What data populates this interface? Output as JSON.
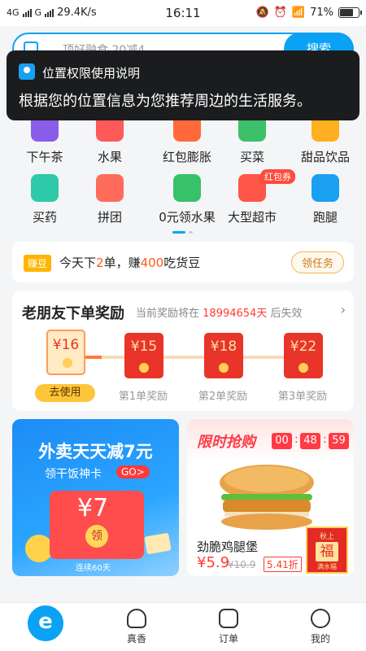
{
  "status_bar": {
    "network_1": "4G",
    "network_2": "G",
    "speed": "29.4K/s",
    "time": "16:11",
    "battery_percent": "71%",
    "battery_level": 0.71
  },
  "search": {
    "placeholder": "顶好融食 20减4",
    "button_label": "搜索"
  },
  "toast": {
    "title": "位置权限使用说明",
    "body": "根据您的位置信息为您推荐周边的生活服务。"
  },
  "categories": [
    {
      "label": "下午茶",
      "icon": "milk-tea-icon",
      "color": "#8a5de8"
    },
    {
      "label": "水果",
      "icon": "strawberry-icon",
      "color": "#ff5a5a"
    },
    {
      "label": "红包膨胀",
      "icon": "red-packet-icon",
      "color": "#ff6a3d"
    },
    {
      "label": "买菜",
      "icon": "broccoli-icon",
      "color": "#3cc06a"
    },
    {
      "label": "甜品饮品",
      "icon": "drink-cup-icon",
      "color": "#ffb020"
    },
    {
      "label": "买药",
      "icon": "medicine-box-icon",
      "color": "#2ec9a8"
    },
    {
      "label": "拼团",
      "icon": "group-fire-icon",
      "color": "#ff6b5b"
    },
    {
      "label": "0元领水果",
      "icon": "tree-icon",
      "color": "#37c26a"
    },
    {
      "label": "大型超市",
      "icon": "shopping-cart-icon",
      "color": "#ff5548",
      "tag": "红包券"
    },
    {
      "label": "跑腿",
      "icon": "runner-icon",
      "color": "#1aa0f0"
    }
  ],
  "bean_bar": {
    "badge": "赚豆",
    "text_before": "今天下",
    "orders": "2",
    "text_mid": "单，赚",
    "beans": "400",
    "text_after": "吃货豆",
    "button": "领任务"
  },
  "reward": {
    "title": "老朋友下单奖励",
    "hint_prefix": "当前奖励将在",
    "countdown": "18994654天",
    "hint_suffix": "后失效",
    "envelopes": [
      {
        "amount": "¥16",
        "label": "去使用"
      },
      {
        "amount": "¥15",
        "label": "第1单奖励"
      },
      {
        "amount": "¥18",
        "label": "第2单奖励"
      },
      {
        "amount": "¥22",
        "label": "第3单奖励"
      }
    ]
  },
  "promo_left": {
    "headline": "外卖天天减7元",
    "subline": "领干饭神卡",
    "go": "GO>",
    "amount": "¥7",
    "coin_text": "领",
    "days": "连续60天"
  },
  "promo_right": {
    "headline": "限时抢购",
    "timer": [
      "00",
      "48",
      "59"
    ],
    "product": "劲脆鸡腿堡",
    "price": "¥5.9",
    "original_price": "¥10.9",
    "discount": "5.41折",
    "badge_top": "秋上",
    "badge_char": "福",
    "badge_bottom": "满水福"
  },
  "tabs": [
    {
      "label": "",
      "icon": "home-icon"
    },
    {
      "label": "真香",
      "icon": "ghost-icon"
    },
    {
      "label": "订单",
      "icon": "order-icon"
    },
    {
      "label": "我的",
      "icon": "profile-icon"
    }
  ],
  "accent_color": "#0aa2f5"
}
